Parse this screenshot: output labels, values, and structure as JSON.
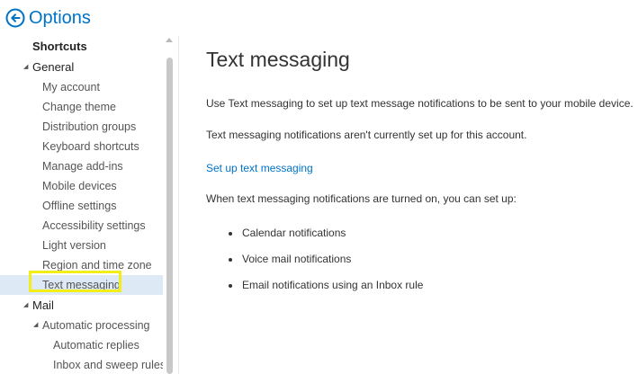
{
  "header": {
    "title": "Options"
  },
  "sidebar": {
    "items": [
      {
        "label": "Shortcuts"
      },
      {
        "label": "General"
      },
      {
        "label": "My account"
      },
      {
        "label": "Change theme"
      },
      {
        "label": "Distribution groups"
      },
      {
        "label": "Keyboard shortcuts"
      },
      {
        "label": "Manage add-ins"
      },
      {
        "label": "Mobile devices"
      },
      {
        "label": "Offline settings"
      },
      {
        "label": "Accessibility settings"
      },
      {
        "label": "Light version"
      },
      {
        "label": "Region and time zone"
      },
      {
        "label": "Text messaging"
      },
      {
        "label": "Mail"
      },
      {
        "label": "Automatic processing"
      },
      {
        "label": "Automatic replies"
      },
      {
        "label": "Inbox and sweep rules"
      }
    ],
    "selected": "Text messaging"
  },
  "main": {
    "title": "Text messaging",
    "intro": "Use Text messaging to set up text message notifications to be sent to your mobile device.",
    "status": "Text messaging notifications aren't currently set up for this account.",
    "setup_link": "Set up text messaging",
    "when_on": "When text messaging notifications are turned on, you can set up:",
    "bullets": [
      "Calendar notifications",
      "Voice mail notifications",
      "Email notifications using an Inbox rule"
    ]
  },
  "colors": {
    "accent": "#0072c6",
    "selected_bg": "#dde9f5",
    "highlight": "#f3ee1a"
  }
}
